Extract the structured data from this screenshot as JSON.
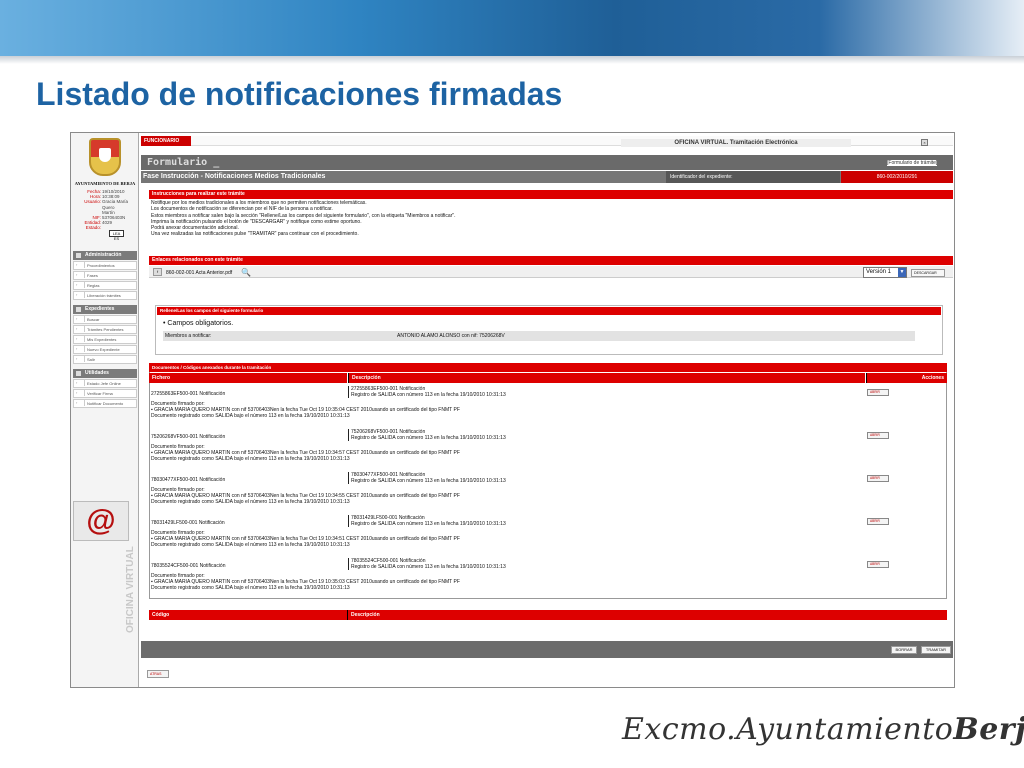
{
  "slide": {
    "title": "Listado de notificaciones firmadas",
    "footer_brand_prefix": "Excmo.Ayuntamiento",
    "footer_brand_suffix": "Berja"
  },
  "app": {
    "top": {
      "funcionario": "FUNCIONARIO",
      "oficina_title": "OFICINA VIRTUAL. Tramitación Electrónica",
      "formulario": "Formulario _",
      "form_type": "[Formulario de trámite]"
    },
    "phase": {
      "label": "Fase Instrucción - Notificaciones Medios Tradicionales",
      "exp_id_label": "Identificador del expediente:",
      "exp_id_value": "860-002/2010/291"
    },
    "sidebar": {
      "municipality": "AYUNTAMIENTO DE BERJA",
      "info": [
        {
          "label": "Fecha:",
          "value": "19/10/2010"
        },
        {
          "label": "Hora:",
          "value": "10:38:09"
        },
        {
          "label": "Usuario:",
          "value": "Gracia María"
        },
        {
          "label": "",
          "value": "Quero"
        },
        {
          "label": "",
          "value": "Martín"
        },
        {
          "label": "NIF:",
          "value": "53706403N"
        },
        {
          "label": "Entidad:",
          "value": "4029"
        },
        {
          "label": "Estado:",
          "value": ""
        }
      ],
      "exit_label": "LEA ES",
      "sections": [
        {
          "title": "Administración",
          "items": [
            "Procedimientos",
            "Fases",
            "Reglas",
            "Liberación trámites"
          ]
        },
        {
          "title": "Expedientes",
          "items": [
            "Buscar",
            "Trámites Pendientes",
            "Mis Expedientes",
            "Nuevo Expediente",
            "Salir"
          ]
        },
        {
          "title": "Utilidades",
          "items": [
            "Estado Jefe Online",
            "Verificar Firma",
            "Notificar Documento"
          ]
        }
      ],
      "vertical_brand": "OFICINA VIRTUAL",
      "at_logo": "@"
    },
    "instructions": {
      "head": "Instrucciones para realizar este trámite",
      "lines": [
        "Notifique por los medios tradicionales a los miembros que no permiten notificaciones telemáticas.",
        "Los documentos de notificación se diferencian por el NIF de la persona a notificar.",
        "Estos miembros a notificar salen bajo la sección \"Rellene/Las los campos del siguiente formulario\", con la etiqueta \"Miembros a notificar\".",
        "Imprima la notificación pulsando el botón de \"DESCARGAR\" y notifique como estime oportuno.",
        "Podrá anexar documentación adicional.",
        "Una vez realizadas las notificaciones pulse \"TRAMITAR\" para continuar con el procedimiento."
      ]
    },
    "enlaces": {
      "head": "Enlaces relacionados con este trámite",
      "file": "860-002-001 Acta Anterior.pdf",
      "version": "Versión 1",
      "descargar": "DESCARGAR"
    },
    "rellene": {
      "head": "Rellene/Las los campos del siguiente formulario",
      "campos": "• Campos obligatorios.",
      "miembros_label": "Miembros a notificar:",
      "miembros_value": "ANTONIO ALAMO ALONSO con nif: 75206268V"
    },
    "documents": {
      "head": "Documentos / Códigos anexados durante la tramitación",
      "col_fichero": "Fichero",
      "col_descripcion": "Descripción",
      "col_acciones": "Acciones",
      "action_label": "ABRIR",
      "sig_line1": "Documento firmado por:",
      "rows": [
        {
          "fichero": "27255863EF500-001 Notificación",
          "desc1": "27255863EF500-001 Notificación",
          "desc2": "Registro de SALIDA con número 113 en la fecha 19/10/2010 10:31:13",
          "signer": "▪  GRACIA MARIA QUERO MARTIN con nif 53706403Nen la fecha Tue Oct 19 10:35:04 CEST 2010usando un certificado del tipo FNMT PF",
          "registered": "Documento registrado como SALIDA bajo el número 113 en la fecha 19/10/2010 10:31:13"
        },
        {
          "fichero": "75206268VF500-001 Notificación",
          "desc1": "75206268VF500-001 Notificación",
          "desc2": "Registro de SALIDA con número 113 en la fecha 19/10/2010 10:31:13",
          "signer": "▪  GRACIA MARIA QUERO MARTIN con nif 53706403Nen la fecha Tue Oct 19 10:34:57 CEST 2010usando un certificado del tipo FNMT PF",
          "registered": "Documento registrado como SALIDA bajo el número 113 en la fecha 19/10/2010 10:31:13"
        },
        {
          "fichero": "78030477XF500-001 Notificación",
          "desc1": "78030477XF500-001 Notificación",
          "desc2": "Registro de SALIDA con número 113 en la fecha 19/10/2010 10:31:13",
          "signer": "▪  GRACIA MARIA QUERO MARTIN con nif 53706403Nen la fecha Tue Oct 19 10:34:55 CEST 2010usando un certificado del tipo FNMT PF",
          "registered": "Documento registrado como SALIDA bajo el número 113 en la fecha 19/10/2010 10:31:13"
        },
        {
          "fichero": "78031429LF500-001 Notificación",
          "desc1": "78031429LF500-001 Notificación",
          "desc2": "Registro de SALIDA con número 113 en la fecha 19/10/2010 10:31:13",
          "signer": "▪  GRACIA MARIA QUERO MARTIN con nif 53706403Nen la fecha Tue Oct 19 10:34:51 CEST 2010usando un certificado del tipo FNMT PF",
          "registered": "Documento registrado como SALIDA bajo el número 113 en la fecha 19/10/2010 10:31:13"
        },
        {
          "fichero": "78035524CF500-001 Notificación",
          "desc1": "78035524CF500-001 Notificación",
          "desc2": "Registro de SALIDA con número 113 en la fecha 19/10/2010 10:31:13",
          "signer": "▪  GRACIA MARIA QUERO MARTIN con nif 53706403Nen la fecha Tue Oct 19 10:35:03 CEST 2010usando un certificado del tipo FNMT PF",
          "registered": "Documento registrado como SALIDA bajo el número 113 en la fecha 19/10/2010 10:31:13"
        }
      ]
    },
    "codes": {
      "col_codigo": "Código",
      "col_descripcion": "Descripción"
    },
    "bottom": {
      "borrar": "BORRAR",
      "tramitar": "TRAMITAR",
      "atras": "ATRAS"
    },
    "colors": {
      "accent_red": "#dd0000",
      "title_blue": "#1d63a3",
      "bar_gray": "#6c6c6c"
    }
  }
}
